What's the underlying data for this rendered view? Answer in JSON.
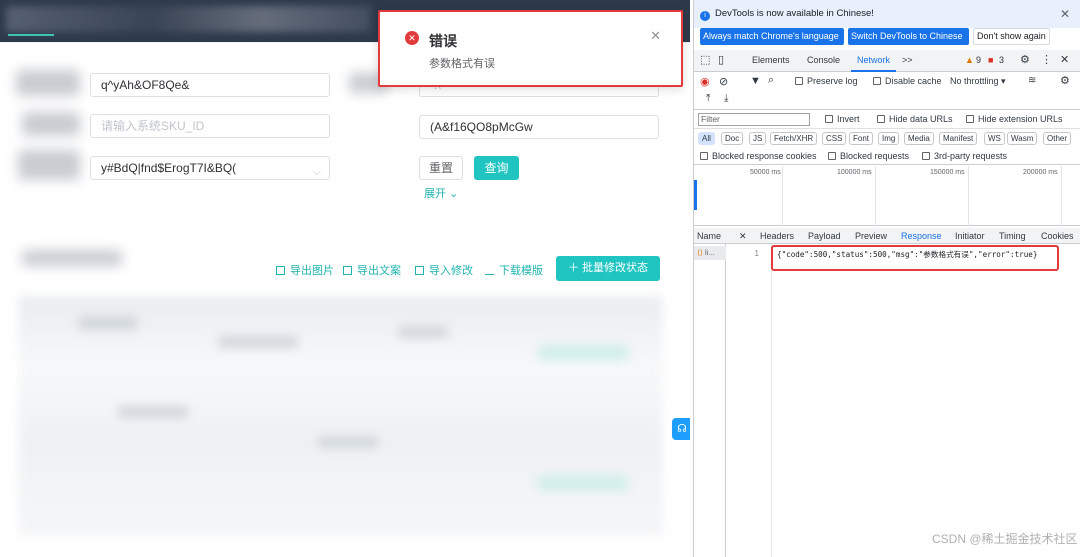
{
  "toast": {
    "title": "错误",
    "message": "参数格式有误"
  },
  "form": {
    "field1_value": "q^yAh&OF8Qe&",
    "sku_placeholder": "请输入系统SKU_ID",
    "select_value": "y#BdQ|fnd$ErogT7I&BQ(",
    "right_value": "(A&f16QO8pMcGw",
    "right_top_value": "-:\\",
    "reset_label": "重置",
    "query_label": "查询",
    "expand_label": "展开"
  },
  "toolbar": {
    "export_image": "导出图片",
    "export_copy": "导出文案",
    "import_edit": "导入修改",
    "download_template": "下载模版",
    "batch_edit": "批量修改状态"
  },
  "devtools": {
    "info_text": "DevTools is now available in Chinese!",
    "btn_match": "Always match Chrome's language",
    "btn_switch": "Switch DevTools to Chinese",
    "btn_dont_show": "Don't show again",
    "tabs": [
      "Elements",
      "Console",
      "Network"
    ],
    "active_tab": "Network",
    "more_tabs": ">>",
    "warn_count": "9",
    "error_count": "3",
    "preserve_log": "Preserve log",
    "disable_cache": "Disable cache",
    "throttling": "No throttling",
    "filter_placeholder": "Filter",
    "invert": "Invert",
    "hide_data_urls": "Hide data URLs",
    "hide_ext_urls": "Hide extension URLs",
    "type_chips": [
      "All",
      "Doc",
      "JS",
      "Fetch/XHR",
      "CSS",
      "Font",
      "Img",
      "Media",
      "Manifest",
      "WS",
      "Wasm",
      "Other"
    ],
    "blocked_cookies": "Blocked response cookies",
    "blocked_requests": "Blocked requests",
    "third_party": "3rd-party requests",
    "ticks": [
      "50000 ms",
      "100000 ms",
      "150000 ms",
      "200000 ms"
    ],
    "name_header": "Name",
    "resp_tabs": [
      "Headers",
      "Payload",
      "Preview",
      "Response",
      "Initiator",
      "Timing",
      "Cookies"
    ],
    "active_resp_tab": "Response",
    "row_name": "li...",
    "line_number": "1",
    "response_body": "{\"code\":500,\"status\":500,\"msg\":\"参数格式有误\",\"error\":true}"
  },
  "watermark": "CSDN @稀土掘金技术社区",
  "colors": {
    "accent": "#20c5c1",
    "error": "#e23b3b",
    "devtools_blue": "#1a73e8"
  }
}
